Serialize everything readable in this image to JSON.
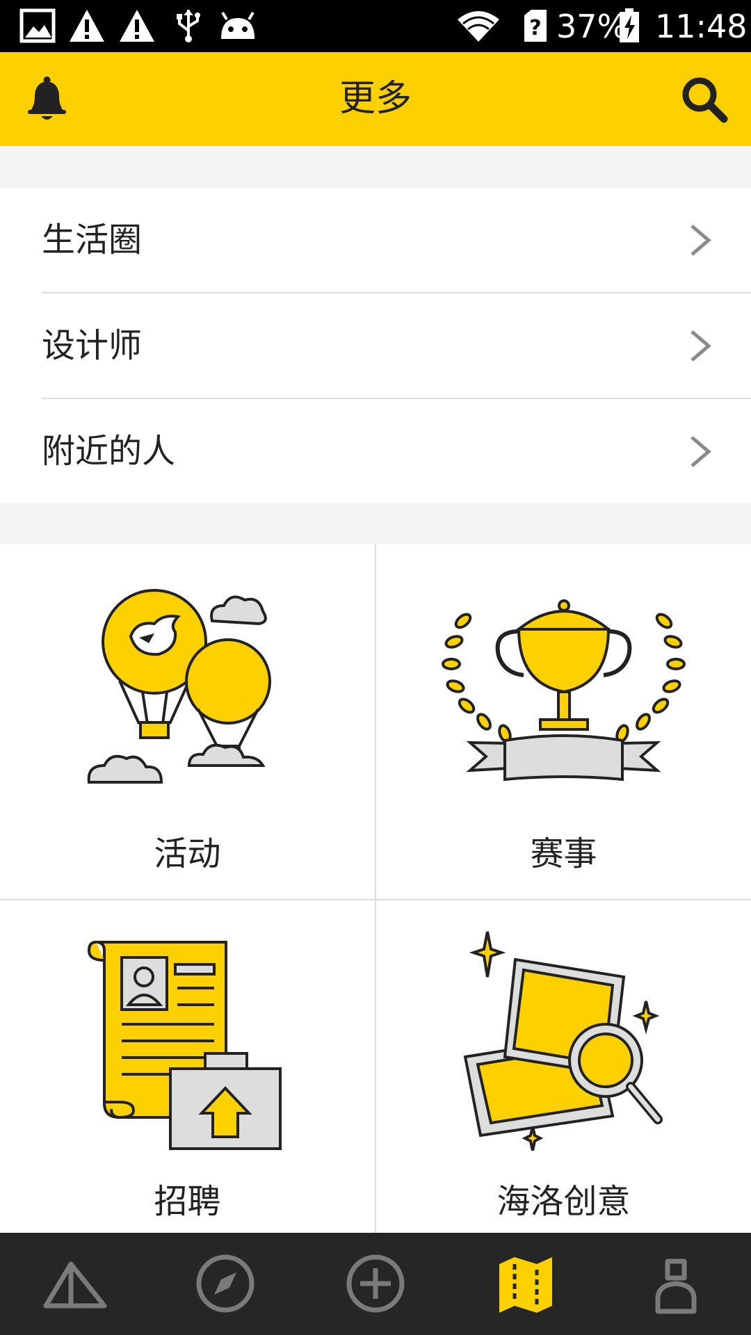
{
  "status_bar": {
    "battery": "37%",
    "time": "11:48"
  },
  "header": {
    "title": "更多",
    "left_icon": "bell-icon",
    "right_icon": "search-icon"
  },
  "list": {
    "items": [
      {
        "label": "生活圈",
        "icon": "chevron-right-icon"
      },
      {
        "label": "设计师",
        "icon": "chevron-right-icon"
      },
      {
        "label": "附近的人",
        "icon": "chevron-right-icon"
      }
    ]
  },
  "grid": {
    "items": [
      {
        "label": "活动",
        "icon": "hot-air-balloon-icon"
      },
      {
        "label": "赛事",
        "icon": "trophy-icon"
      },
      {
        "label": "招聘",
        "icon": "resume-briefcase-icon"
      },
      {
        "label": "海洛创意",
        "icon": "photos-magnifier-icon"
      }
    ]
  },
  "bottom_nav": {
    "items": [
      {
        "icon": "tent-icon"
      },
      {
        "icon": "compass-icon"
      },
      {
        "icon": "add-circle-icon"
      },
      {
        "icon": "map-icon",
        "active": true
      },
      {
        "icon": "profile-icon"
      }
    ]
  },
  "colors": {
    "accent": "#FDD000",
    "nav_background": "#262626",
    "nav_inactive": "#7a7a7a"
  }
}
